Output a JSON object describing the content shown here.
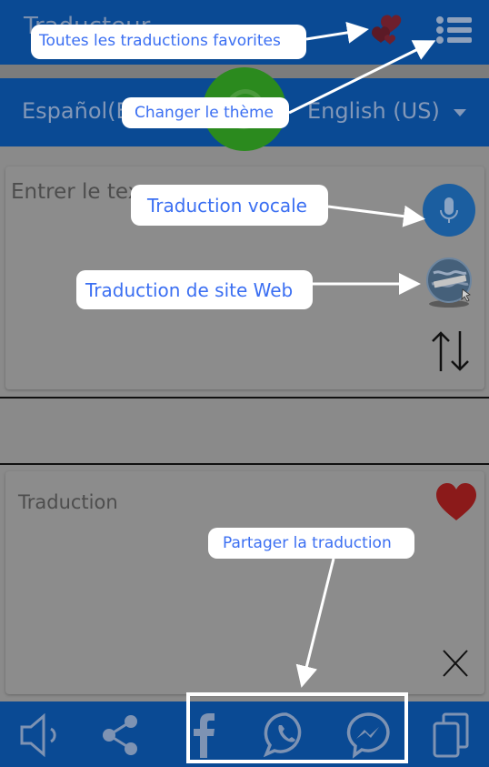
{
  "app": {
    "title": "Traducteur"
  },
  "languages": {
    "source": "Español(E",
    "target": "English (US)"
  },
  "input": {
    "placeholder": "Entrer le tex"
  },
  "output": {
    "placeholder": "Traduction"
  },
  "icons": {
    "favorites": "hearts-icon",
    "theme": "list-menu-icon",
    "swap_languages": "refresh-icon",
    "voice": "microphone-icon",
    "website": "globe-icon",
    "reverse": "swap-arrows-icon",
    "favorite_translation": "heart-icon",
    "clear": "close-icon",
    "speak": "speaker-icon",
    "share": "share-icon",
    "facebook": "facebook-icon",
    "whatsapp": "whatsapp-icon",
    "messenger": "messenger-icon",
    "copy": "copy-icon"
  },
  "tooltips": {
    "favorites": "Toutes les traductions favorites",
    "theme": "Changer le thème",
    "voice": "Traduction vocale",
    "website": "Traduction de site Web",
    "share": "Partager la traduction"
  },
  "colors": {
    "bar_blue": "#0a4a94",
    "swap_green": "#2b8a1e",
    "tooltip_text": "#3b6ff2",
    "heart_red": "#8b1a1a"
  }
}
